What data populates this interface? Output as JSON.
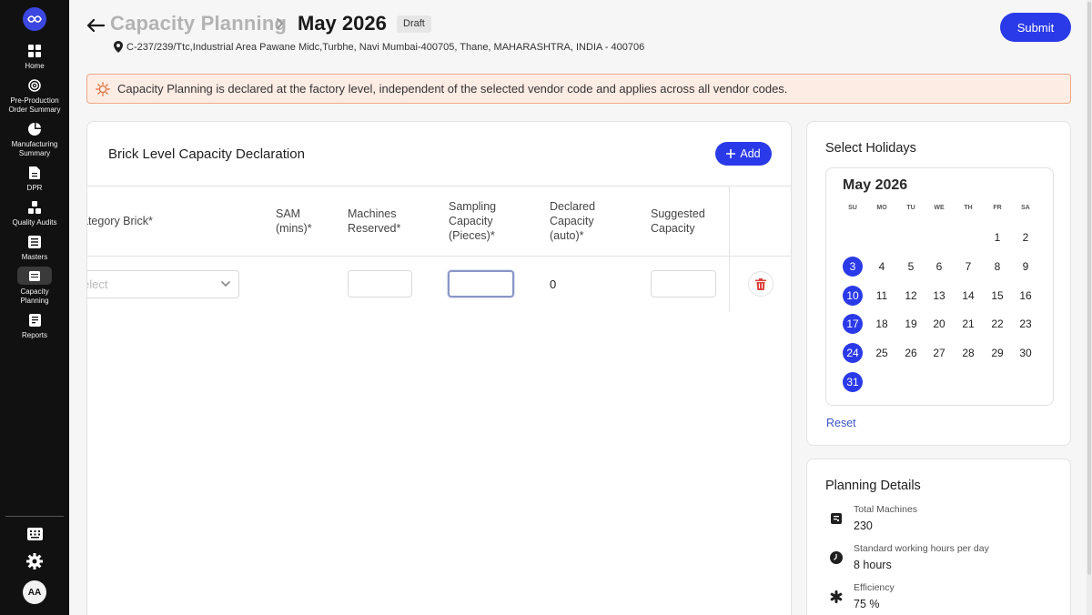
{
  "sidebar": {
    "items": [
      {
        "label": "Home",
        "icon": "grid-icon"
      },
      {
        "label": "Pre-Production Order Summary",
        "icon": "spiral-icon"
      },
      {
        "label": "Manufacturing Summary",
        "icon": "pie-icon"
      },
      {
        "label": "DPR",
        "icon": "document-icon"
      },
      {
        "label": "Quality Audits",
        "icon": "squares-icon"
      },
      {
        "label": "Masters",
        "icon": "list-icon"
      },
      {
        "label": "Capacity Planning",
        "icon": "calendar-icon"
      },
      {
        "label": "Reports",
        "icon": "report-icon"
      }
    ],
    "avatar": "AA"
  },
  "header": {
    "parent": "Capacity Planning",
    "current": "May 2026",
    "status": "Draft",
    "address": "C-237/239/Ttc,Industrial Area Pawane Midc,Turbhe, Navi Mumbai-400705, Thane, MAHARASHTRA, INDIA - 400706",
    "submit_label": "Submit"
  },
  "banner": {
    "text": "Capacity Planning is declared at the factory level, independent of the selected vendor code and applies across all vendor codes."
  },
  "declaration": {
    "title": "Brick Level Capacity Declaration",
    "add_label": "Add",
    "columns": [
      "ategory Brick*",
      "SAM (mins)*",
      "Machines Reserved*",
      "Sampling Capacity (Pieces)*",
      "Declared Capacity (auto)*",
      "Suggested Capacity"
    ],
    "row": {
      "brick_placeholder": "elect",
      "declared": "0"
    }
  },
  "holidays": {
    "title": "Select Holidays",
    "month": "May 2026",
    "weekdays": [
      "SU",
      "MO",
      "TU",
      "WE",
      "TH",
      "FR",
      "SA"
    ],
    "first_weekday": 5,
    "days_in_month": 31,
    "selected_days": [
      3,
      10,
      17,
      24,
      31
    ],
    "reset_label": "Reset"
  },
  "planning": {
    "title": "Planning Details",
    "details": [
      {
        "label": "Total Machines",
        "value": "230",
        "icon": "machine-icon"
      },
      {
        "label": "Standard working hours per day",
        "value": "8 hours",
        "icon": "clock-icon"
      },
      {
        "label": "Efficiency",
        "value": "75 %",
        "icon": "efficiency-icon"
      }
    ]
  },
  "colors": {
    "accent": "#2b3ae8",
    "sidebar": "#111111",
    "banner_bg": "#fdece4",
    "banner_border": "#f0a989",
    "delete": "#d9453d"
  }
}
